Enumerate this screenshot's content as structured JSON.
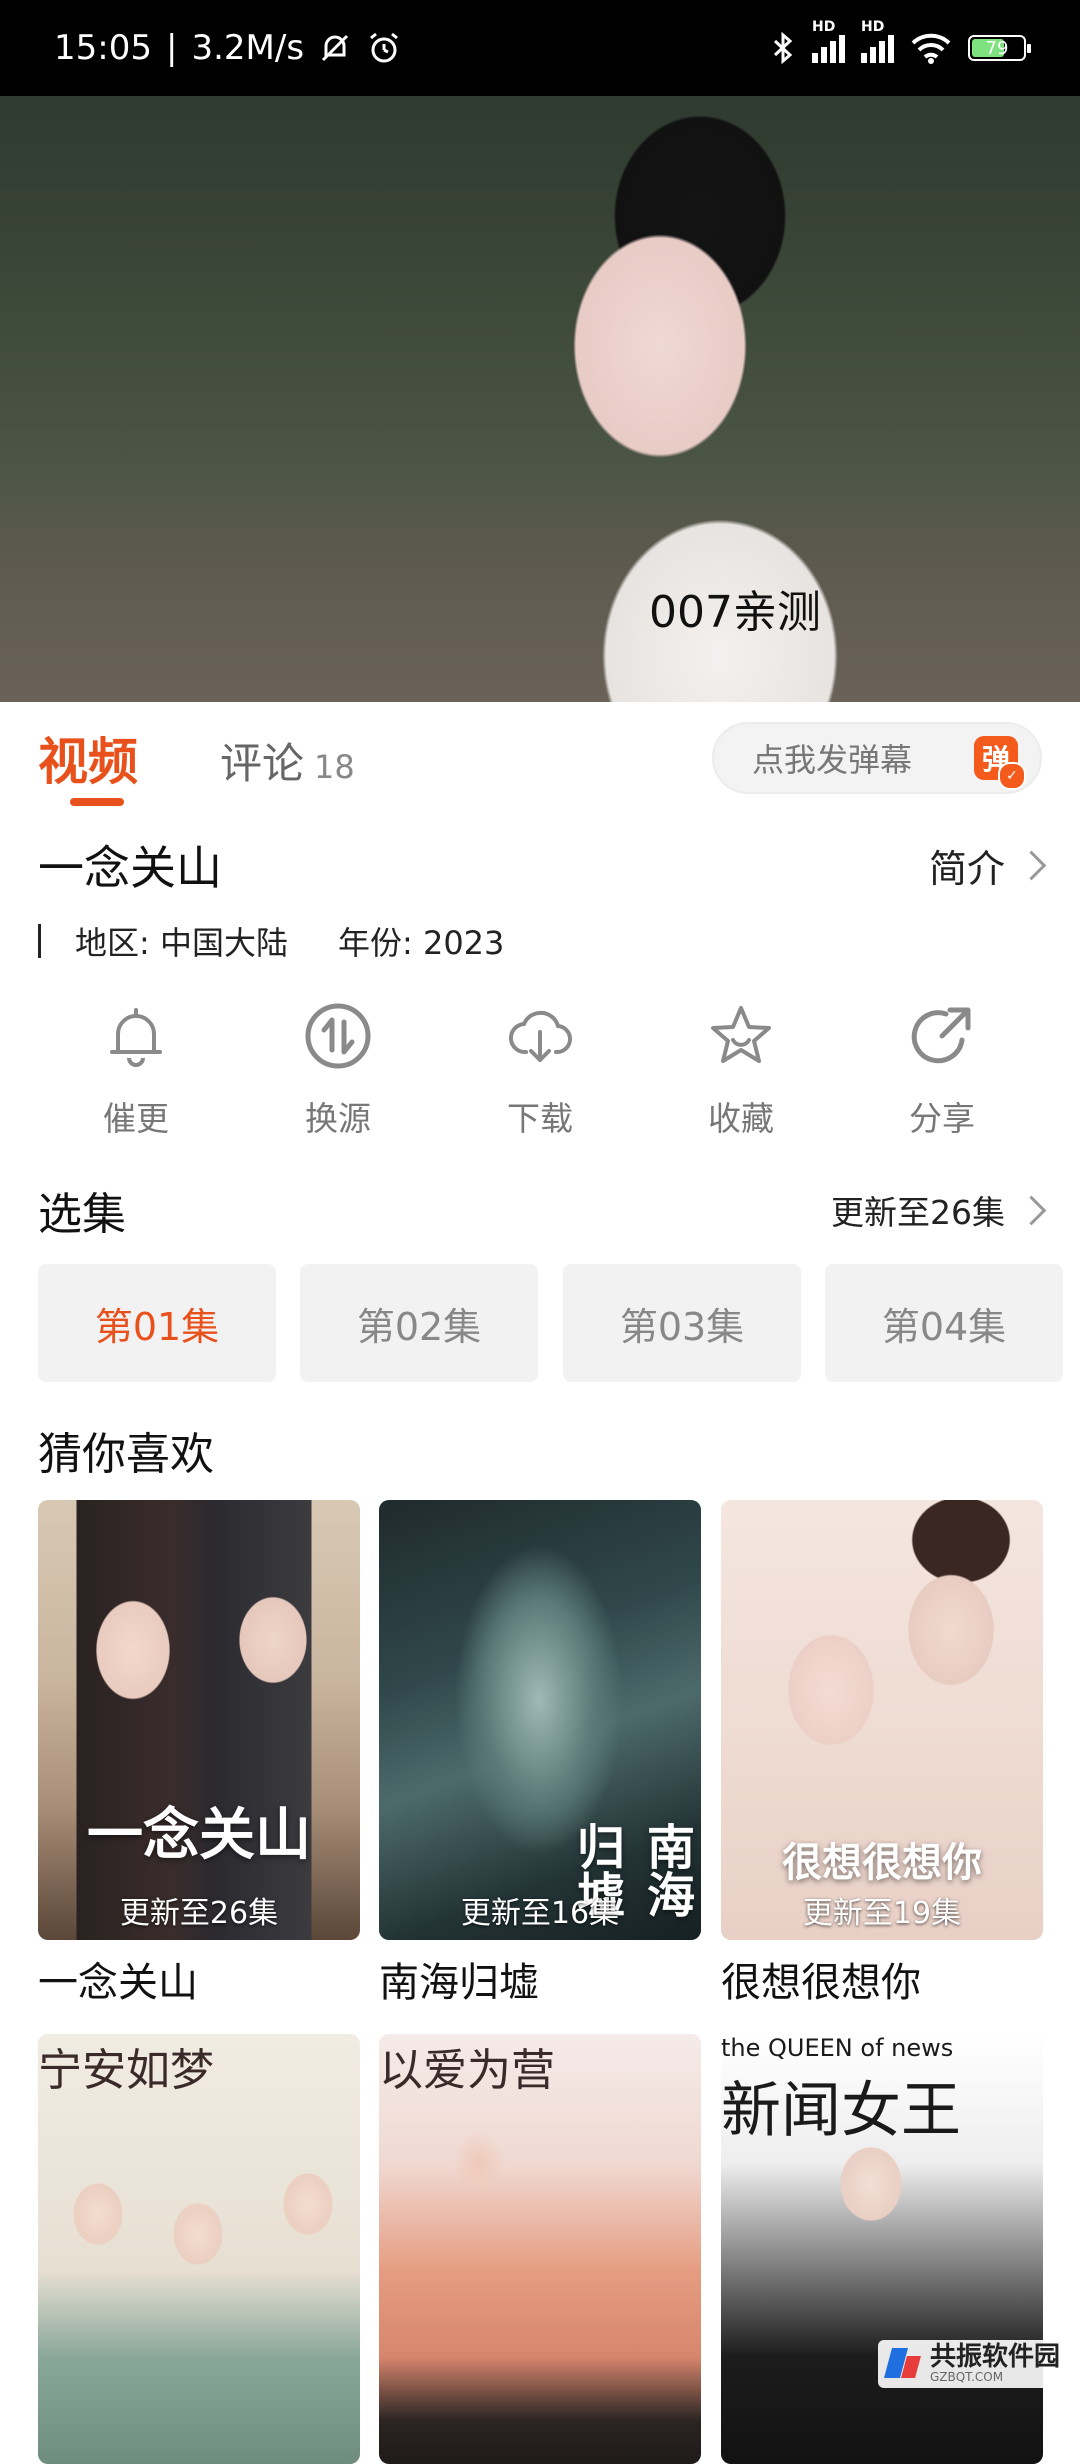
{
  "status_bar": {
    "time": "15:05",
    "speed": "3.2M/s",
    "network_label": "HD",
    "battery": "79"
  },
  "player": {
    "subtitle": "007亲测"
  },
  "tabs": {
    "video": "视频",
    "comments": "评论",
    "comment_count": "18",
    "danmu_placeholder": "点我发弹幕",
    "danmu_icon_char": "弹"
  },
  "show": {
    "title": "一念关山",
    "intro_label": "简介",
    "region_label": "地区:",
    "region": "中国大陆",
    "year_label": "年份:",
    "year": "2023"
  },
  "actions": [
    {
      "label": "催更",
      "icon": "bell-icon"
    },
    {
      "label": "换源",
      "icon": "switch-source-icon"
    },
    {
      "label": "下载",
      "icon": "download-cloud-icon"
    },
    {
      "label": "收藏",
      "icon": "star-icon"
    },
    {
      "label": "分享",
      "icon": "share-icon"
    }
  ],
  "episodes": {
    "title": "选集",
    "update_status": "更新至26集",
    "items": [
      "第01集",
      "第02集",
      "第03集",
      "第04集"
    ],
    "active_index": 0
  },
  "recommend": {
    "title": "猜你喜欢",
    "items": [
      {
        "name": "一念关山",
        "badge": "更新至26集",
        "poster_text": "一念关山"
      },
      {
        "name": "南海归墟",
        "badge": "更新至16集",
        "poster_text": "南海归墟"
      },
      {
        "name": "很想很想你",
        "badge": "更新至19集",
        "poster_text": "很想很想你"
      },
      {
        "name": "",
        "badge": "",
        "poster_text": "宁安如梦"
      },
      {
        "name": "",
        "badge": "",
        "poster_text": "以爱为营"
      },
      {
        "name": "",
        "badge": "",
        "poster_text": "新闻女王",
        "poster_subtext": "the QUEEN of news"
      }
    ]
  },
  "watermark": {
    "name": "共振软件园",
    "url": "GZBQT.COM"
  },
  "colors": {
    "accent": "#e8511c",
    "chip_bg": "#f2f2f2",
    "status_bg": "#000000"
  }
}
